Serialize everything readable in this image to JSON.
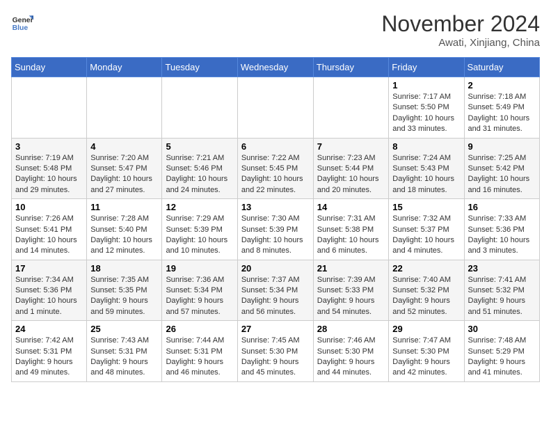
{
  "logo": {
    "line1": "General",
    "line2": "Blue"
  },
  "title": "November 2024",
  "location": "Awati, Xinjiang, China",
  "weekdays": [
    "Sunday",
    "Monday",
    "Tuesday",
    "Wednesday",
    "Thursday",
    "Friday",
    "Saturday"
  ],
  "weeks": [
    [
      {
        "day": "",
        "info": ""
      },
      {
        "day": "",
        "info": ""
      },
      {
        "day": "",
        "info": ""
      },
      {
        "day": "",
        "info": ""
      },
      {
        "day": "",
        "info": ""
      },
      {
        "day": "1",
        "info": "Sunrise: 7:17 AM\nSunset: 5:50 PM\nDaylight: 10 hours and 33 minutes."
      },
      {
        "day": "2",
        "info": "Sunrise: 7:18 AM\nSunset: 5:49 PM\nDaylight: 10 hours and 31 minutes."
      }
    ],
    [
      {
        "day": "3",
        "info": "Sunrise: 7:19 AM\nSunset: 5:48 PM\nDaylight: 10 hours and 29 minutes."
      },
      {
        "day": "4",
        "info": "Sunrise: 7:20 AM\nSunset: 5:47 PM\nDaylight: 10 hours and 27 minutes."
      },
      {
        "day": "5",
        "info": "Sunrise: 7:21 AM\nSunset: 5:46 PM\nDaylight: 10 hours and 24 minutes."
      },
      {
        "day": "6",
        "info": "Sunrise: 7:22 AM\nSunset: 5:45 PM\nDaylight: 10 hours and 22 minutes."
      },
      {
        "day": "7",
        "info": "Sunrise: 7:23 AM\nSunset: 5:44 PM\nDaylight: 10 hours and 20 minutes."
      },
      {
        "day": "8",
        "info": "Sunrise: 7:24 AM\nSunset: 5:43 PM\nDaylight: 10 hours and 18 minutes."
      },
      {
        "day": "9",
        "info": "Sunrise: 7:25 AM\nSunset: 5:42 PM\nDaylight: 10 hours and 16 minutes."
      }
    ],
    [
      {
        "day": "10",
        "info": "Sunrise: 7:26 AM\nSunset: 5:41 PM\nDaylight: 10 hours and 14 minutes."
      },
      {
        "day": "11",
        "info": "Sunrise: 7:28 AM\nSunset: 5:40 PM\nDaylight: 10 hours and 12 minutes."
      },
      {
        "day": "12",
        "info": "Sunrise: 7:29 AM\nSunset: 5:39 PM\nDaylight: 10 hours and 10 minutes."
      },
      {
        "day": "13",
        "info": "Sunrise: 7:30 AM\nSunset: 5:39 PM\nDaylight: 10 hours and 8 minutes."
      },
      {
        "day": "14",
        "info": "Sunrise: 7:31 AM\nSunset: 5:38 PM\nDaylight: 10 hours and 6 minutes."
      },
      {
        "day": "15",
        "info": "Sunrise: 7:32 AM\nSunset: 5:37 PM\nDaylight: 10 hours and 4 minutes."
      },
      {
        "day": "16",
        "info": "Sunrise: 7:33 AM\nSunset: 5:36 PM\nDaylight: 10 hours and 3 minutes."
      }
    ],
    [
      {
        "day": "17",
        "info": "Sunrise: 7:34 AM\nSunset: 5:36 PM\nDaylight: 10 hours and 1 minute."
      },
      {
        "day": "18",
        "info": "Sunrise: 7:35 AM\nSunset: 5:35 PM\nDaylight: 9 hours and 59 minutes."
      },
      {
        "day": "19",
        "info": "Sunrise: 7:36 AM\nSunset: 5:34 PM\nDaylight: 9 hours and 57 minutes."
      },
      {
        "day": "20",
        "info": "Sunrise: 7:37 AM\nSunset: 5:34 PM\nDaylight: 9 hours and 56 minutes."
      },
      {
        "day": "21",
        "info": "Sunrise: 7:39 AM\nSunset: 5:33 PM\nDaylight: 9 hours and 54 minutes."
      },
      {
        "day": "22",
        "info": "Sunrise: 7:40 AM\nSunset: 5:32 PM\nDaylight: 9 hours and 52 minutes."
      },
      {
        "day": "23",
        "info": "Sunrise: 7:41 AM\nSunset: 5:32 PM\nDaylight: 9 hours and 51 minutes."
      }
    ],
    [
      {
        "day": "24",
        "info": "Sunrise: 7:42 AM\nSunset: 5:31 PM\nDaylight: 9 hours and 49 minutes."
      },
      {
        "day": "25",
        "info": "Sunrise: 7:43 AM\nSunset: 5:31 PM\nDaylight: 9 hours and 48 minutes."
      },
      {
        "day": "26",
        "info": "Sunrise: 7:44 AM\nSunset: 5:31 PM\nDaylight: 9 hours and 46 minutes."
      },
      {
        "day": "27",
        "info": "Sunrise: 7:45 AM\nSunset: 5:30 PM\nDaylight: 9 hours and 45 minutes."
      },
      {
        "day": "28",
        "info": "Sunrise: 7:46 AM\nSunset: 5:30 PM\nDaylight: 9 hours and 44 minutes."
      },
      {
        "day": "29",
        "info": "Sunrise: 7:47 AM\nSunset: 5:30 PM\nDaylight: 9 hours and 42 minutes."
      },
      {
        "day": "30",
        "info": "Sunrise: 7:48 AM\nSunset: 5:29 PM\nDaylight: 9 hours and 41 minutes."
      }
    ]
  ]
}
